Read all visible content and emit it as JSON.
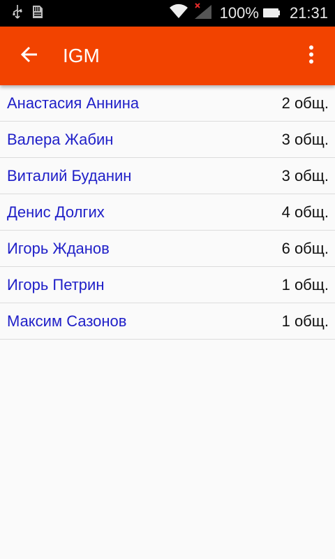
{
  "status_bar": {
    "battery_percent": "100%",
    "time": "21:31",
    "icons": [
      "usb-icon",
      "sd-card-icon",
      "wifi-icon",
      "no-signal-icon",
      "battery-icon"
    ]
  },
  "app_bar": {
    "title": "IGM",
    "background_color": "#f24300",
    "icons": [
      "back-arrow-icon",
      "more-vert-icon"
    ]
  },
  "list": {
    "items": [
      {
        "name": "Анастасия Аннина",
        "count": "2 общ."
      },
      {
        "name": "Валера Жабин",
        "count": "3 общ."
      },
      {
        "name": "Виталий Буданин",
        "count": "3 общ."
      },
      {
        "name": "Денис Долгих",
        "count": "4 общ."
      },
      {
        "name": "Игорь Жданов",
        "count": "6 общ."
      },
      {
        "name": "Игорь Петрин",
        "count": "1 общ."
      },
      {
        "name": "Максим Сазонов",
        "count": "1 общ."
      }
    ],
    "name_color": "#1f1fc8"
  }
}
